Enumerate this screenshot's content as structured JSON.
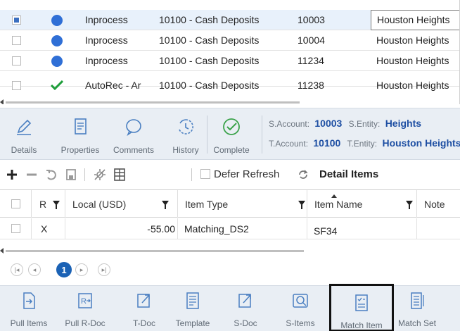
{
  "top_grid": {
    "rows": [
      {
        "selected": true,
        "status_icon": "blue-dot-icon",
        "status": "Inprocess",
        "account": "10100 - Cash Deposits",
        "number": "10003",
        "entity": "Houston Heights"
      },
      {
        "selected": false,
        "status_icon": "blue-dot-icon",
        "status": "Inprocess",
        "account": "10100 - Cash Deposits",
        "number": "10004",
        "entity": "Houston Heights"
      },
      {
        "selected": false,
        "status_icon": "blue-dot-icon",
        "status": "Inprocess",
        "account": "10100 - Cash Deposits",
        "number": "11234",
        "entity": "Houston Heights"
      },
      {
        "selected": false,
        "status_icon": "green-check-icon",
        "status": "AutoRec - Ar",
        "account": "10100 - Cash Deposits",
        "number": "11238",
        "entity": "Houston Heights"
      }
    ]
  },
  "mid_toolbar": {
    "buttons": [
      {
        "label": "Details",
        "icon": "pencil-icon"
      },
      {
        "label": "Properties",
        "icon": "document-list-icon"
      },
      {
        "label": "Comments",
        "icon": "speech-bubble-icon"
      },
      {
        "label": "History",
        "icon": "history-clock-icon"
      },
      {
        "label": "Complete",
        "icon": "complete-check-icon"
      }
    ],
    "source": {
      "account_label": "S.Account:",
      "account_value": "10003",
      "entity_label": "S.Entity:",
      "entity_value": "Heights"
    },
    "target": {
      "account_label": "T.Account:",
      "account_value": "10100",
      "entity_label": "T.Entity:",
      "entity_value": "Houston Heights"
    }
  },
  "detail_toolbar": {
    "defer_refresh_label": "Defer Refresh",
    "title": "Detail Items"
  },
  "detail_grid": {
    "columns": [
      "R",
      "Local (USD)",
      "Item Type",
      "Item Name",
      "Note"
    ],
    "rows": [
      {
        "r": "X",
        "local_usd": "-55.00",
        "item_type": "Matching_DS2",
        "item_name": "SF34",
        "note": ""
      }
    ]
  },
  "pager": {
    "current_page": "1"
  },
  "bottom_toolbar": {
    "buttons": [
      {
        "label": "Pull Items",
        "icon": "pull-items-icon"
      },
      {
        "label": "Pull R-Doc",
        "icon": "pull-rdoc-icon"
      },
      {
        "label": "T-Doc",
        "icon": "tdoc-icon"
      },
      {
        "label": "Template",
        "icon": "template-icon"
      },
      {
        "label": "S-Doc",
        "icon": "sdoc-icon"
      },
      {
        "label": "S-Items",
        "icon": "sitems-icon"
      },
      {
        "label": "Match Item",
        "icon": "match-item-icon"
      },
      {
        "label": "Match Set",
        "icon": "match-set-icon"
      }
    ],
    "selected": "Match Item"
  },
  "colors": {
    "accent_blue": "#2f6fd6",
    "green_check": "#1e9e3a",
    "toolbar_bg": "#e9eef4",
    "icon_blue": "#4a7fc1",
    "complete_green": "#3aa24a",
    "page_active": "#1b62b5"
  }
}
